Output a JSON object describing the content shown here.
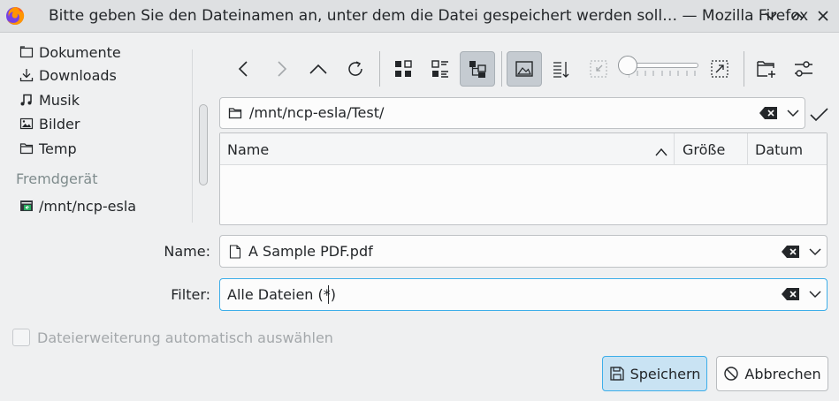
{
  "window": {
    "title": "Bitte geben Sie den Dateinamen an, unter dem die Datei gespeichert werden soll… — Mozilla Firefox"
  },
  "sidebar": {
    "items": [
      {
        "label": "Dokumente",
        "icon": "document-folder-icon"
      },
      {
        "label": "Downloads",
        "icon": "download-icon"
      },
      {
        "label": "Musik",
        "icon": "music-note-icon"
      },
      {
        "label": "Bilder",
        "icon": "picture-icon"
      },
      {
        "label": "Temp",
        "icon": "folder-icon"
      }
    ],
    "remote_heading": "Fremdgerät",
    "remote_items": [
      {
        "label": "/mnt/ncp-esla",
        "icon": "network-drive-icon"
      }
    ]
  },
  "toolbar": {
    "buttons": [
      "back-icon",
      "forward-icon",
      "up-icon",
      "reload-icon",
      "icon-view-icon",
      "compact-view-icon",
      "tree-view-icon",
      "preview-icon",
      "sort-icon",
      "zoom-reset-icon",
      "zoom-icon",
      "new-folder-icon",
      "options-icon"
    ]
  },
  "path": {
    "value": "/mnt/ncp-esla/Test/"
  },
  "table": {
    "columns": [
      "Name",
      "Größe",
      "Datum"
    ],
    "rows": []
  },
  "name_field": {
    "label": "Name:",
    "value": "A Sample PDF.pdf"
  },
  "filter_field": {
    "label": "Filter:",
    "value": "Alle Dateien (*)"
  },
  "extension_checkbox": {
    "label": "Dateierweiterung automatisch auswählen",
    "checked": false,
    "enabled": false
  },
  "buttons": {
    "save": "Speichern",
    "cancel": "Abbrechen"
  },
  "colors": {
    "accent": "#3daee9",
    "window_bg": "#eff0f1",
    "titlebar_bg": "#dee0e2"
  }
}
